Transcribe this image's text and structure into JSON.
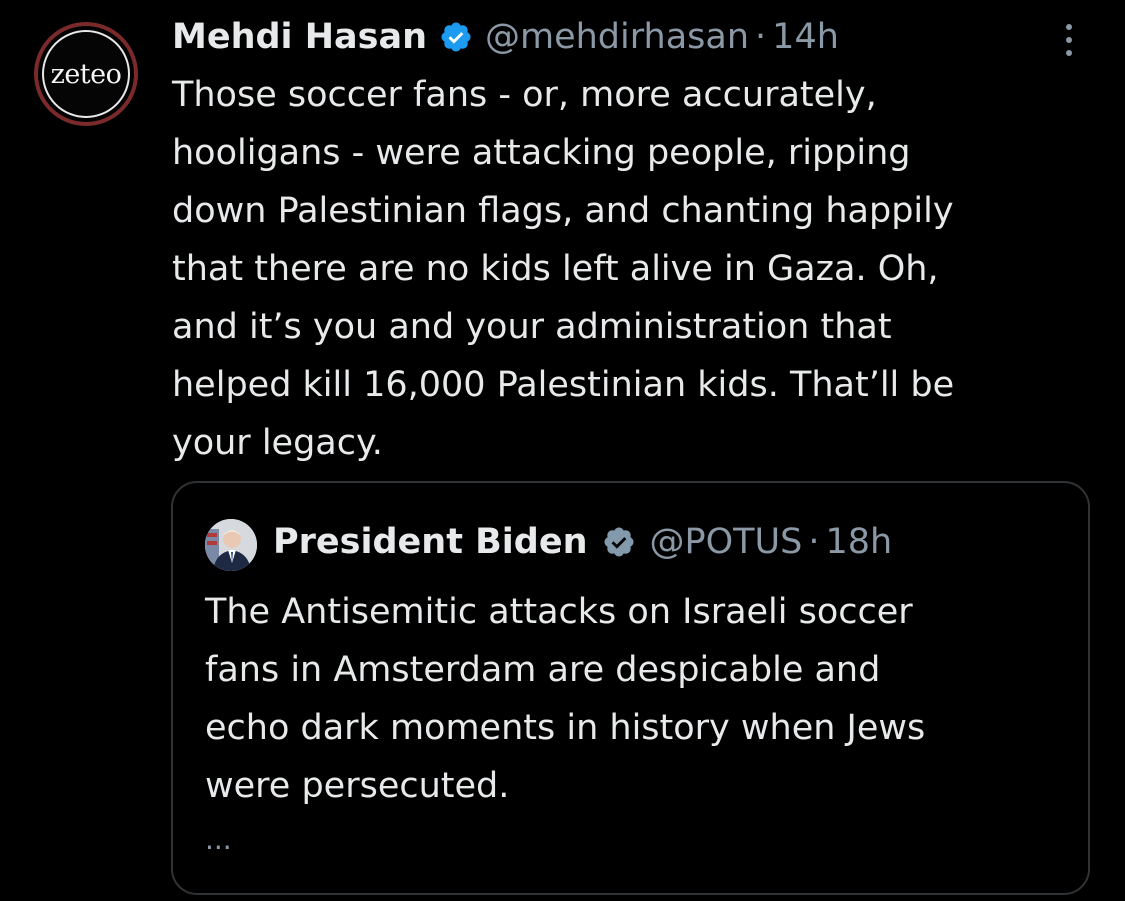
{
  "tweet": {
    "author": {
      "avatar_text": "zeteo",
      "name": "Mehdi Hasan",
      "handle": "@mehdirhasan",
      "separator": "·",
      "time": "14h"
    },
    "text_lines": [
      "Those soccer fans - or, more accurately,",
      "hooligans - were attacking people, ripping",
      "down Palestinian flags, and chanting happily",
      "that there are no kids left alive in Gaza. Oh,",
      "and it’s you and your administration that",
      "helped kill 16,000 Palestinian kids. That’ll be",
      "your legacy."
    ],
    "more_icon": "more-vertical-icon",
    "verified_icon": "verified-badge-icon"
  },
  "quoted": {
    "author": {
      "name": "President Biden",
      "handle": "@POTUS",
      "separator": "·",
      "time": "18h"
    },
    "text_lines": [
      "The Antisemitic attacks on Israeli soccer",
      "fans in Amsterdam are despicable and",
      "echo dark moments in history when Jews",
      "were persecuted."
    ],
    "ellipsis": "...",
    "verified_icon": "verified-badge-gray-icon"
  },
  "colors": {
    "background": "#000000",
    "text": "#e7e9ea",
    "secondary_text": "#8b98a5",
    "verified_blue": "#1d9bf0",
    "border": "#2f3336"
  }
}
